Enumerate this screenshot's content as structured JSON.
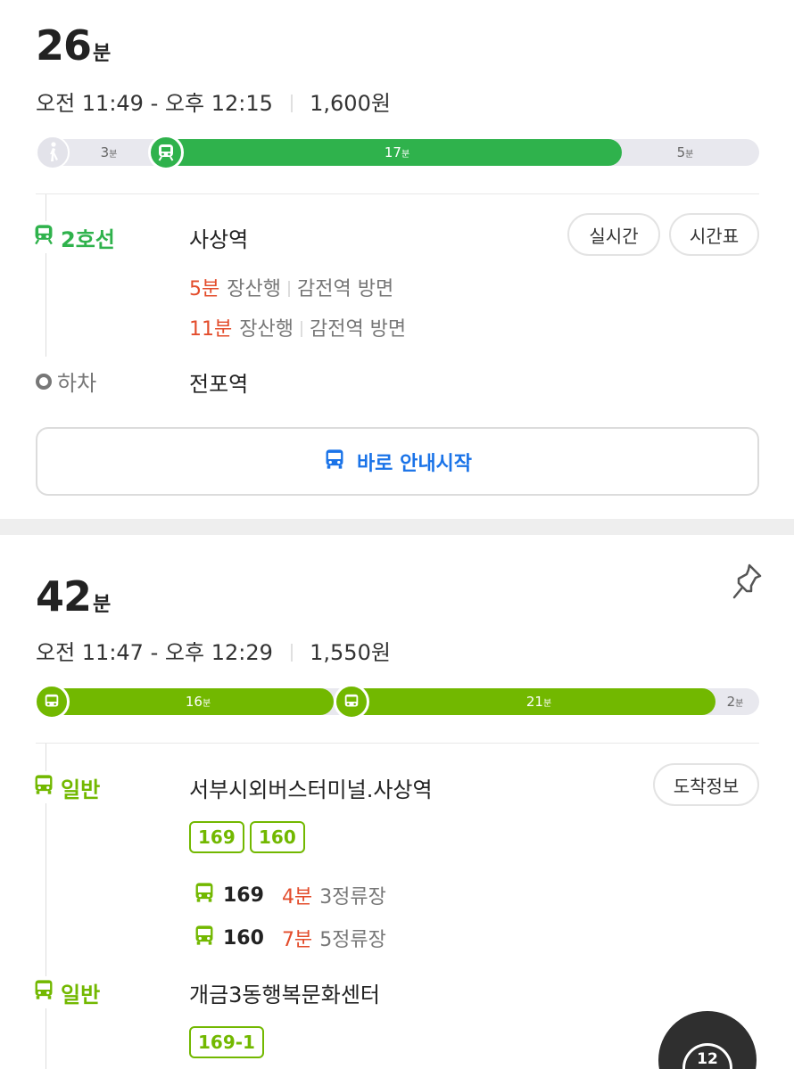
{
  "route1": {
    "duration_num": "26",
    "duration_unit": "분",
    "departure": "오전 11:49",
    "dash": "-",
    "arrival": "오후 12:15",
    "fare": "1,600원",
    "segments": [
      {
        "icon": "walk-icon",
        "minutes": "3",
        "unit": "분"
      },
      {
        "icon": "subway-icon",
        "minutes": "17",
        "unit": "분"
      },
      {
        "icon": "walk-icon",
        "minutes": "5",
        "unit": "분"
      }
    ],
    "line_name": "2호선",
    "board_station": "사상역",
    "realtime_label": "실시간",
    "timetable_label": "시간표",
    "arrivals": [
      {
        "min": "5분",
        "dest": "장산행",
        "direction": "감전역 방면"
      },
      {
        "min": "11분",
        "dest": "장산행",
        "direction": "감전역 방면"
      }
    ],
    "alight_label": "하차",
    "alight_station": "전포역",
    "start_label": "바로 안내시작"
  },
  "route2": {
    "duration_num": "42",
    "duration_unit": "분",
    "departure": "오전 11:47",
    "dash": "-",
    "arrival": "오후 12:29",
    "fare": "1,550원",
    "segments": [
      {
        "icon": "bus-icon",
        "minutes": "16",
        "unit": "분"
      },
      {
        "icon": "bus-icon",
        "minutes": "21",
        "unit": "분"
      },
      {
        "icon": "walk-icon",
        "minutes": "2",
        "unit": "분"
      }
    ],
    "leg1": {
      "mode_label": "일반",
      "station": "서부시외버스터미널.사상역",
      "arrival_info_label": "도착정보",
      "routes": [
        "169",
        "160"
      ],
      "arrivals": [
        {
          "bus": "169",
          "min": "4분",
          "stops": "3정류장"
        },
        {
          "bus": "160",
          "min": "7분",
          "stops": "5정류장"
        }
      ]
    },
    "leg2": {
      "mode_label": "일반",
      "station": "개금3동행복문화센터",
      "routes": [
        "169-1"
      ]
    }
  },
  "fab_label": "12",
  "colors": {
    "subway_green": "#2fb24c",
    "bus_green": "#72b800",
    "minutes_red": "#e34c2b",
    "start_blue": "#1a73e8"
  }
}
